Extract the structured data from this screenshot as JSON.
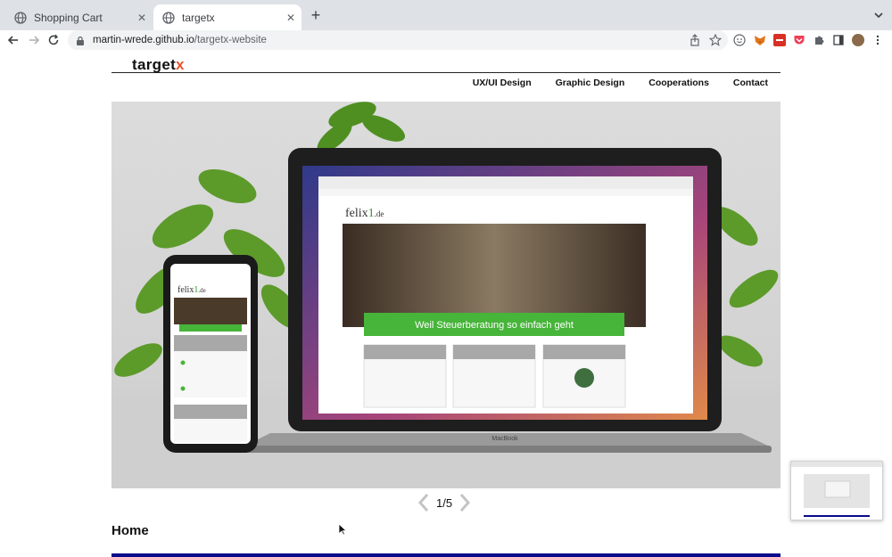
{
  "browser": {
    "tabs": [
      {
        "title": "Shopping Cart",
        "active": false
      },
      {
        "title": "targetx",
        "active": true
      }
    ],
    "new_tab_icon": "plus-icon",
    "url_host": "martin-wrede.github.io",
    "url_path": "/targetx-website",
    "accent": "#1a73e8"
  },
  "site": {
    "logo_text": "target",
    "logo_accent_text": "x",
    "logo_accent_color": "#e8542a",
    "nav": [
      {
        "label": "UX/UI Design"
      },
      {
        "label": "Graphic Design"
      },
      {
        "label": "Cooperations"
      },
      {
        "label": "Contact"
      }
    ],
    "hero": {
      "laptop_banner": "Weil Steuerberatung so einfach geht",
      "laptop_brand": "MacBook",
      "site_brand": "felix1.de"
    },
    "pager": {
      "label": "1/5",
      "current": 1,
      "total": 5
    },
    "section_title": "Home",
    "bar_color": "#0a0a8a"
  }
}
